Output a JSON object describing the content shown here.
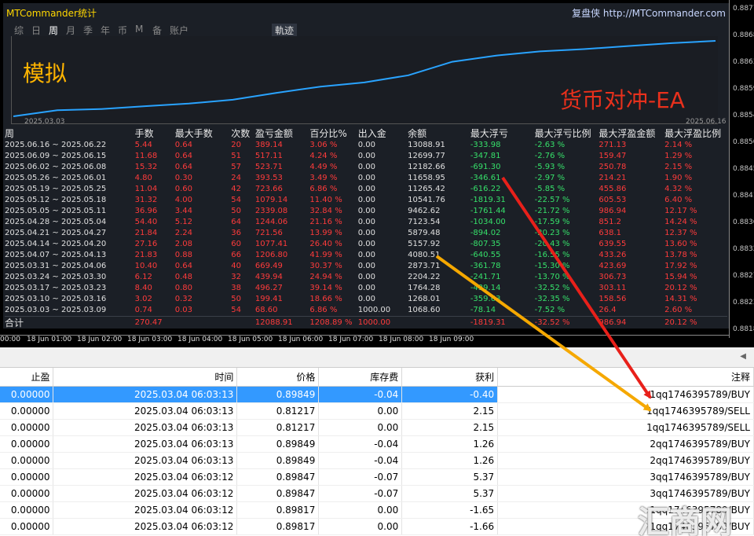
{
  "panel": {
    "title": "MTCommander统计",
    "link": "复盘侠 http://MTCommander.com",
    "tabs": [
      "综",
      "日",
      "周",
      "月",
      "季",
      "年",
      "币",
      "M",
      "备",
      "账户"
    ],
    "active_tab": "周",
    "track_label": "軌迹",
    "overlay_left": "模拟",
    "overlay_right": "货币对冲-EA",
    "date_start": "2025.03.03",
    "date_end": "2025.06.16"
  },
  "price_axis": [
    "0.88770",
    "0.88685",
    "0.88635",
    "0.88590",
    "0.88545",
    "0.88500",
    "0.88455",
    "0.88410",
    "0.88365",
    "0.88320",
    "0.88275",
    "0.88230",
    "0.88185"
  ],
  "time_axis": [
    "00:00",
    "18 Jun 01:00",
    "18 Jun 02:00",
    "18 Jun 03:00",
    "18 Jun 04:00",
    "18 Jun 05:00",
    "18 Jun 06:00",
    "18 Jun 07:00",
    "18 Jun 08:00",
    "18 Jun 09:00"
  ],
  "stats": {
    "headers": [
      "周",
      "手数",
      "最大手数",
      "次数",
      "盈亏金额",
      "百分比%",
      "出入金",
      "余额",
      "最大浮亏",
      "最大浮亏比例",
      "最大浮盈金额",
      "最大浮盈比例"
    ],
    "rows": [
      [
        "2025.06.16 ~ 2025.06.22",
        "5.44",
        "0.64",
        "20",
        "389.14",
        "3.06 %",
        "0.00",
        "13088.91",
        "-333.98",
        "-2.63 %",
        "271.13",
        "2.14 %"
      ],
      [
        "2025.06.09 ~ 2025.06.15",
        "11.68",
        "0.64",
        "51",
        "517.11",
        "4.24 %",
        "0.00",
        "12699.77",
        "-347.81",
        "-2.76 %",
        "159.47",
        "1.29 %"
      ],
      [
        "2025.06.02 ~ 2025.06.08",
        "15.32",
        "0.64",
        "57",
        "523.71",
        "4.49 %",
        "0.00",
        "12182.66",
        "-691.30",
        "-5.93 %",
        "250.78",
        "2.15 %"
      ],
      [
        "2025.05.26 ~ 2025.06.01",
        "4.80",
        "0.30",
        "24",
        "393.53",
        "3.49 %",
        "0.00",
        "11658.95",
        "-346.61",
        "-2.97 %",
        "214.21",
        "1.90 %"
      ],
      [
        "2025.05.19 ~ 2025.05.25",
        "11.04",
        "0.60",
        "42",
        "723.66",
        "6.86 %",
        "0.00",
        "11265.42",
        "-616.22",
        "-5.85 %",
        "455.86",
        "4.32 %"
      ],
      [
        "2025.05.12 ~ 2025.05.18",
        "31.32",
        "4.00",
        "54",
        "1079.14",
        "11.40 %",
        "0.00",
        "10541.76",
        "-1819.31",
        "-22.57 %",
        "605.53",
        "6.40 %"
      ],
      [
        "2025.05.05 ~ 2025.05.11",
        "36.96",
        "3.44",
        "50",
        "2339.08",
        "32.84 %",
        "0.00",
        "9462.62",
        "-1761.44",
        "-21.72 %",
        "986.94",
        "12.17 %"
      ],
      [
        "2025.04.28 ~ 2025.05.04",
        "54.40",
        "5.12",
        "64",
        "1244.06",
        "21.16 %",
        "0.00",
        "7123.54",
        "-1034.00",
        "-17.59 %",
        "851.2",
        "14.24 %"
      ],
      [
        "2025.04.21 ~ 2025.04.27",
        "21.84",
        "2.24",
        "36",
        "721.56",
        "13.99 %",
        "0.00",
        "5879.48",
        "-894.02",
        "-20.23 %",
        "638.1",
        "12.37 %"
      ],
      [
        "2025.04.14 ~ 2025.04.20",
        "27.16",
        "2.08",
        "60",
        "1077.41",
        "26.40 %",
        "0.00",
        "5157.92",
        "-807.35",
        "-20.43 %",
        "639.55",
        "13.60 %"
      ],
      [
        "2025.04.07 ~ 2025.04.13",
        "21.83",
        "0.88",
        "66",
        "1206.80",
        "41.99 %",
        "0.00",
        "4080.51",
        "-640.55",
        "-16.55 %",
        "433.26",
        "13.78 %"
      ],
      [
        "2025.03.31 ~ 2025.04.06",
        "10.40",
        "0.64",
        "40",
        "669.49",
        "30.37 %",
        "0.00",
        "2873.71",
        "-361.78",
        "-15.30 %",
        "423.69",
        "17.92 %"
      ],
      [
        "2025.03.24 ~ 2025.03.30",
        "6.12",
        "0.48",
        "32",
        "439.94",
        "24.94 %",
        "0.00",
        "2204.22",
        "-241.71",
        "-13.70 %",
        "306.73",
        "15.94 %"
      ],
      [
        "2025.03.17 ~ 2025.03.23",
        "8.40",
        "0.80",
        "38",
        "496.27",
        "39.14 %",
        "0.00",
        "1764.28",
        "-439.14",
        "-32.52 %",
        "303.11",
        "20.12 %"
      ],
      [
        "2025.03.10 ~ 2025.03.16",
        "3.02",
        "0.32",
        "50",
        "199.41",
        "18.66 %",
        "0.00",
        "1268.01",
        "-359.63",
        "-32.35 %",
        "158.56",
        "14.31 %"
      ],
      [
        "2025.03.03 ~ 2025.03.09",
        "0.74",
        "0.03",
        "54",
        "68.60",
        "6.86 %",
        "1000.00",
        "1068.60",
        "-78.14",
        "-7.52 %",
        "26.4",
        "2.60 %"
      ]
    ],
    "total": [
      "合计",
      "270.47",
      "",
      "",
      "12088.91",
      "1208.89 %",
      "1000.00",
      "",
      "-1819.31",
      "-32.52 %",
      "986.94",
      "20.12 %"
    ]
  },
  "orders": {
    "headers": [
      "止盈",
      "时间",
      "价格",
      "库存费",
      "获利",
      "注释"
    ],
    "rows": [
      [
        "0.00000",
        "2025.03.04 06:03:13",
        "0.89849",
        "-0.04",
        "-0.40",
        "1qq1746395789/BUY"
      ],
      [
        "0.00000",
        "2025.03.04 06:03:13",
        "0.81217",
        "0.00",
        "2.15",
        "1qq1746395789/SELL"
      ],
      [
        "0.00000",
        "2025.03.04 06:03:13",
        "0.81217",
        "0.00",
        "2.15",
        "1qq1746395789/SELL"
      ],
      [
        "0.00000",
        "2025.03.04 06:03:13",
        "0.89849",
        "-0.04",
        "1.26",
        "2qq1746395789/BUY"
      ],
      [
        "0.00000",
        "2025.03.04 06:03:13",
        "0.89849",
        "-0.04",
        "1.26",
        "2qq1746395789/BUY"
      ],
      [
        "0.00000",
        "2025.03.04 06:03:12",
        "0.89847",
        "-0.07",
        "5.37",
        "3qq1746395789/BUY"
      ],
      [
        "0.00000",
        "2025.03.04 06:03:12",
        "0.89847",
        "-0.07",
        "5.37",
        "3qq1746395789/BUY"
      ],
      [
        "0.00000",
        "2025.03.04 06:03:12",
        "0.89817",
        "0.00",
        "-1.65",
        "1qq1746395789/BUY"
      ],
      [
        "0.00000",
        "2025.03.04 06:03:12",
        "0.89817",
        "0.00",
        "-1.66",
        "1qq1746395789/BUY"
      ]
    ]
  },
  "watermark": "汇商网",
  "colors": {
    "equity_line": "#29a3ff",
    "arrow_red": "#e8201a",
    "arrow_orange": "#f5a800",
    "selection": "#3399ff"
  }
}
